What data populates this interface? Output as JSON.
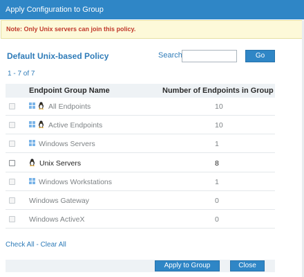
{
  "dialog": {
    "title": "Apply Configuration to Group",
    "note": "Note: Only Unix servers can join this policy."
  },
  "policy": {
    "title": "Default Unix-based Policy"
  },
  "search": {
    "label": "Search",
    "value": "",
    "placeholder": "",
    "go_label": "Go"
  },
  "pagination": {
    "count_text": "1 - 7 of 7"
  },
  "table": {
    "headers": {
      "name": "Endpoint Group Name",
      "count": "Number of Endpoints in Group"
    },
    "rows": [
      {
        "name": "All Endpoints",
        "count": "10",
        "icons": [
          "windows-icon",
          "linux-icon"
        ],
        "enabled": false
      },
      {
        "name": "Active Endpoints",
        "count": "10",
        "icons": [
          "windows-icon",
          "linux-icon"
        ],
        "enabled": false
      },
      {
        "name": "Windows Servers",
        "count": "1",
        "icons": [
          "windows-icon"
        ],
        "enabled": false
      },
      {
        "name": "Unix Servers",
        "count": "8",
        "icons": [
          "linux-icon"
        ],
        "enabled": true
      },
      {
        "name": "Windows Workstations",
        "count": "1",
        "icons": [
          "windows-icon"
        ],
        "enabled": false
      },
      {
        "name": "Windows Gateway",
        "count": "0",
        "icons": [],
        "enabled": false
      },
      {
        "name": "Windows ActiveX",
        "count": "0",
        "icons": [],
        "enabled": false
      }
    ]
  },
  "selection": {
    "check_all": "Check All",
    "separator": " - ",
    "clear_all": "Clear All"
  },
  "footer": {
    "apply_label": "Apply to Group",
    "close_label": "Close"
  },
  "colors": {
    "title_bar": "#2f86c6",
    "note_text": "#c0392b",
    "link": "#2e7bb8",
    "button": "#2f86c6"
  }
}
